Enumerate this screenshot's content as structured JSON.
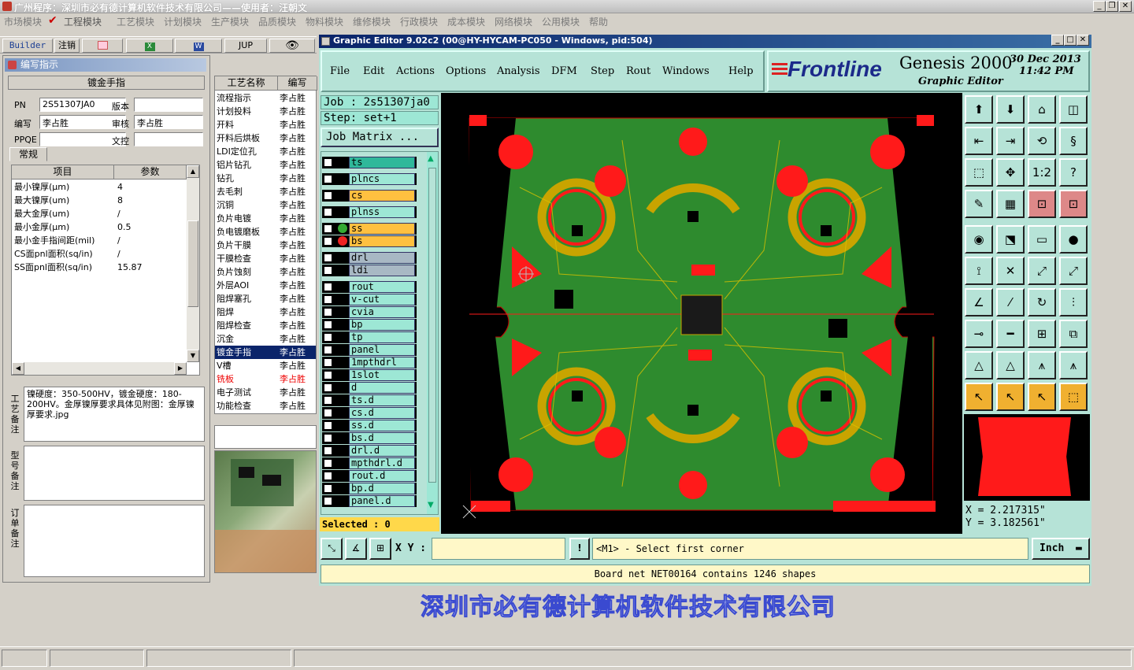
{
  "app": {
    "title": "广州程序：深圳市必有德计算机软件技术有限公司——使用者：汪朝文",
    "menu": [
      "市场模块",
      "工程模块",
      "工艺模块",
      "计划模块",
      "生产模块",
      "品质模块",
      "物料模块",
      "维修模块",
      "行政模块",
      "成本模块",
      "网络模块",
      "公用模块",
      "帮助"
    ]
  },
  "toolbar": {
    "builder": "Builder",
    "note": "注销",
    "jup": "JUP"
  },
  "panel": {
    "title": "编写指示",
    "subtitle": "镀金手指",
    "tab": "常规"
  },
  "form": {
    "pn_label": "PN",
    "pn_value": "2S51307JA0",
    "version_label": "版本",
    "version_value": "",
    "author_label": "编写",
    "author_value": "李占胜",
    "reviewer_label": "审核",
    "reviewer_value": "李占胜",
    "ppqe_label": "PPQE",
    "ppqe_value": "",
    "control_label": "文控",
    "control_value": ""
  },
  "params": {
    "headers": [
      "项目",
      "参数"
    ],
    "rows": [
      {
        "item": "最小镍厚(μm)",
        "value": "4"
      },
      {
        "item": "最大镍厚(um)",
        "value": "8"
      },
      {
        "item": "最大金厚(um)",
        "value": "/"
      },
      {
        "item": "最小金厚(μm)",
        "value": "0.5"
      },
      {
        "item": "最小金手指间距(mil)",
        "value": "/"
      },
      {
        "item": "CS面pnl面积(sq/in)",
        "value": "/"
      },
      {
        "item": "SS面pnl面积(sq/in)",
        "value": "15.87"
      }
    ]
  },
  "process": {
    "headers": [
      "工艺名称",
      "编写"
    ],
    "rows": [
      {
        "name": "流程指示",
        "by": "李占胜"
      },
      {
        "name": "计划投料",
        "by": "李占胜"
      },
      {
        "name": "开料",
        "by": "李占胜"
      },
      {
        "name": "开料后烘板",
        "by": "李占胜"
      },
      {
        "name": "LDI定位孔",
        "by": "李占胜"
      },
      {
        "name": "铝片钻孔",
        "by": "李占胜"
      },
      {
        "name": "钻孔",
        "by": "李占胜"
      },
      {
        "name": "去毛刺",
        "by": "李占胜"
      },
      {
        "name": "沉铜",
        "by": "李占胜"
      },
      {
        "name": "负片电镀",
        "by": "李占胜"
      },
      {
        "name": "负电镀磨板",
        "by": "李占胜"
      },
      {
        "name": "负片干膜",
        "by": "李占胜"
      },
      {
        "name": "干膜检查",
        "by": "李占胜"
      },
      {
        "name": "负片蚀刻",
        "by": "李占胜"
      },
      {
        "name": "外层AOI",
        "by": "李占胜"
      },
      {
        "name": "阻焊塞孔",
        "by": "李占胜"
      },
      {
        "name": "阻焊",
        "by": "李占胜"
      },
      {
        "name": "阻焊检查",
        "by": "李占胜"
      },
      {
        "name": "沉金",
        "by": "李占胜"
      },
      {
        "name": "镀金手指",
        "by": "李占胜"
      },
      {
        "name": "V槽",
        "by": "李占胜"
      },
      {
        "name": "铣板",
        "by": "李占胜"
      },
      {
        "name": "电子测试",
        "by": "李占胜"
      },
      {
        "name": "功能检查",
        "by": "李占胜"
      }
    ]
  },
  "notes": {
    "process_label": "工艺备注",
    "process_text": "镍硬度：350-500HV，镀金硬度：180-200HV。金厚镍厚要求具体见附图：金厚镍厚要求.jpg",
    "model_label": "型号备注",
    "order_label": "订单备注"
  },
  "ge": {
    "title": "Graphic Editor 9.02c2 (00@HY-HYCAM-PC050 - Windows, pid:504)",
    "menu": [
      "File",
      "Edit",
      "Actions",
      "Options",
      "Analysis",
      "DFM",
      "Step",
      "Rout",
      "Windows",
      "Help"
    ],
    "brand": "Frontline",
    "product": "Genesis 2000",
    "subtitle": "Graphic Editor",
    "date": "30 Dec 2013",
    "time": "11:42 PM",
    "job": "Job : 2s51307ja0",
    "step": "Step: set+1",
    "matrix_btn": "Job Matrix ...",
    "layers": [
      "ts",
      "plncs",
      "cs",
      "plnss",
      "ss",
      "bs",
      "drl",
      "ldi",
      "rout",
      "v-cut",
      "cvia",
      "bp",
      "tp",
      "panel",
      "1mpthdrl",
      "1slot",
      "d",
      "ts.d",
      "cs.d",
      "ss.d",
      "bs.d",
      "drl.d",
      "mpthdrl.d",
      "rout.d",
      "bp.d",
      "panel.d"
    ],
    "selected": "Selected : 0",
    "coord_x": "X = 2.217315\"",
    "coord_y": "Y = 3.182561\"",
    "xy_label": "X Y :",
    "xy_value": "",
    "prompt": "<M1> - Select first corner",
    "units": "Inch",
    "status": "Board net NET00164 contains 1246 shapes"
  },
  "watermark": "深圳市必有德计算机软件技术有限公司",
  "colors": {
    "board_green": "#2e8b2e",
    "copper_red": "#ff1a1a",
    "pad_gold": "#c8a400",
    "ge_teal": "#b6e3d7"
  }
}
